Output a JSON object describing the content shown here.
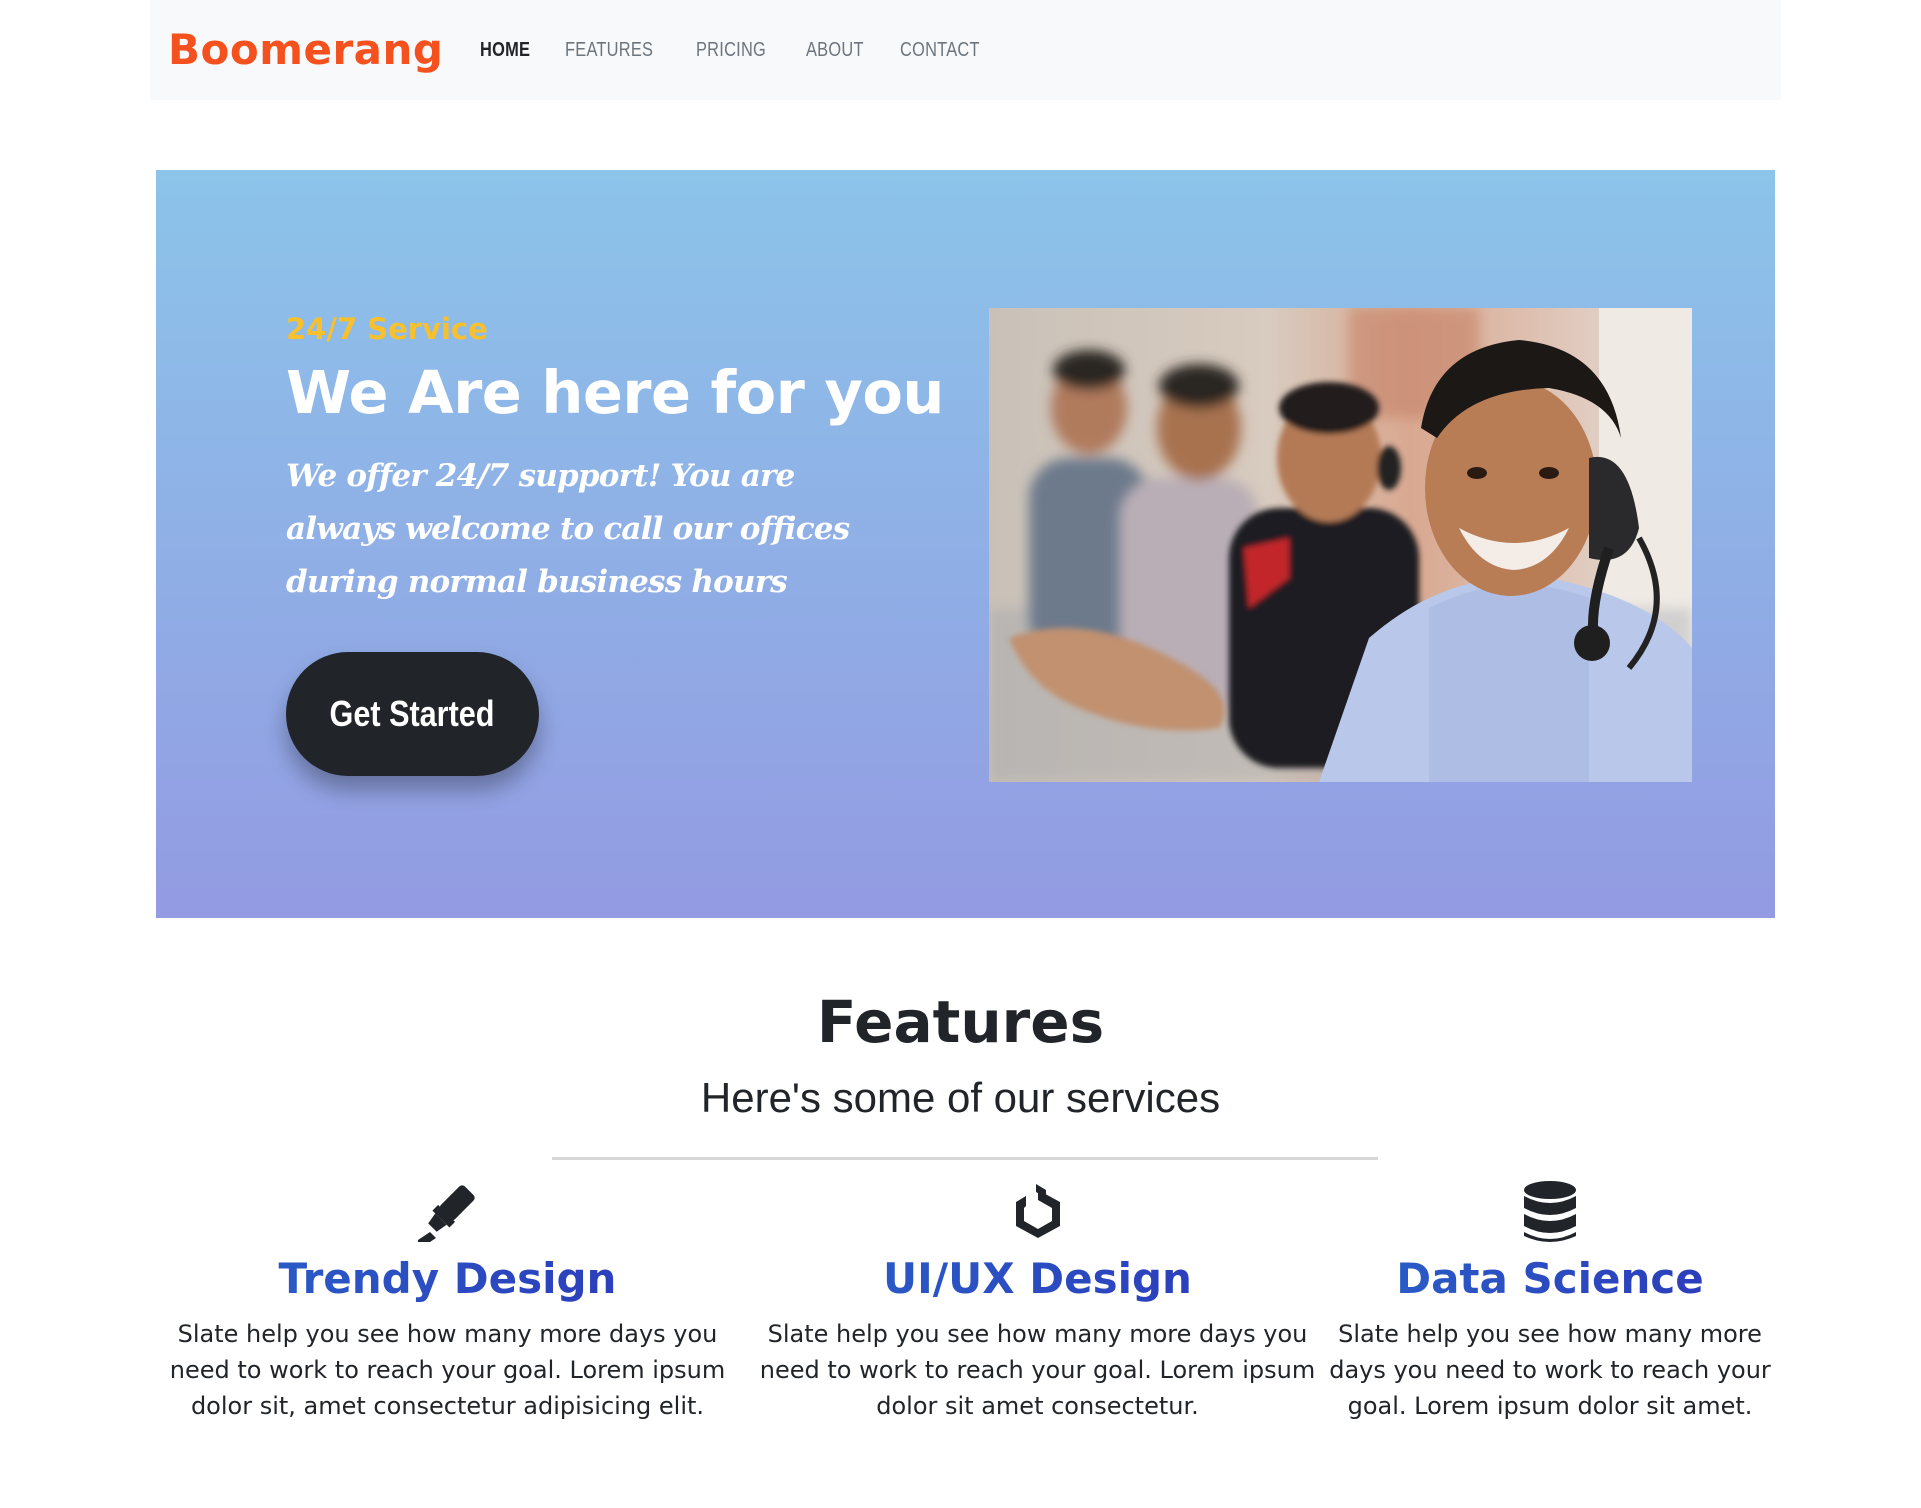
{
  "brand": "Boomerang",
  "nav": [
    {
      "label": "Home",
      "active": true
    },
    {
      "label": "Features",
      "active": false
    },
    {
      "label": "Pricing",
      "active": false
    },
    {
      "label": "About",
      "active": false
    },
    {
      "label": "Contact",
      "active": false
    }
  ],
  "hero": {
    "eyebrow": "24/7 Service",
    "title": "We Are here for you",
    "text": "We offer 24/7 support! You are always welcome to call our offices during normal business hours",
    "cta": "Get Started",
    "gradient_top": "#8cc4ea",
    "gradient_bottom": "#939be2"
  },
  "features": {
    "title": "Features",
    "subtitle": "Here's some of our services",
    "items": [
      {
        "icon": "highlighter-icon",
        "title": "Trendy Design",
        "text": "Slate help you see how many more days you need to work to reach your goal. Lorem ipsum dolor sit, amet consectetur adipisicing elit."
      },
      {
        "icon": "uikit-icon",
        "title": "UI/UX Design",
        "text": "Slate help you see how many more days you need to work to reach your goal. Lorem ipsum dolor sit amet consectetur."
      },
      {
        "icon": "database-icon",
        "title": "Data Science",
        "text": "Slate help you see how many more days you need to work to reach your goal. Lorem ipsum dolor sit amet."
      }
    ]
  },
  "colors": {
    "brand": "#f4511e",
    "eyebrow": "#f9c02d",
    "feature_title": "#2a4fc0",
    "button": "#212529"
  }
}
